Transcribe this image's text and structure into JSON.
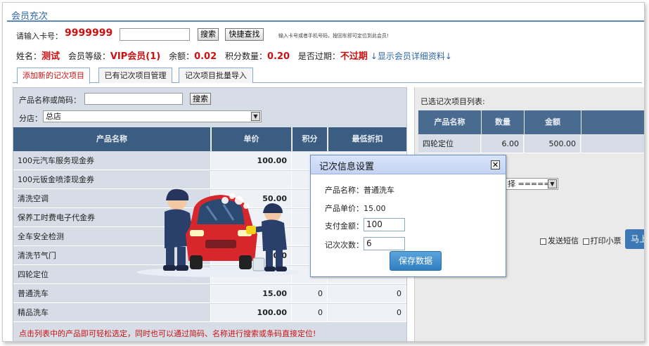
{
  "page": {
    "title": "会员充次"
  },
  "member": {
    "card_label": "请输入卡号：",
    "card_value": "9999999",
    "search_btn": "搜索",
    "quick_btn": "快捷查找",
    "hint": "输入卡号或者手机号码，按回车即可定位到此会员!",
    "name_label": "姓名：",
    "name_value": "测试",
    "level_label": "会员等级：",
    "level_value": "VIP会员(1)",
    "balance_label": "余额：",
    "balance_value": "0.02",
    "points_label": "积分数量：",
    "points_value": "0.20",
    "expired_label": "是否过期：",
    "expired_value": "不过期",
    "detail_link": "↓显示会员详细资料↓"
  },
  "tabs": [
    "添加新的记次项目",
    "已有记次项目管理",
    "记次项目批量导入"
  ],
  "left": {
    "search_label": "产品名称或简码：",
    "search_btn": "搜索",
    "store_label": "分店：",
    "store_value": "总店",
    "headers": [
      "产品名称",
      "单价",
      "积分",
      "最低折扣"
    ],
    "rows": [
      {
        "name": "100元汽车服务现金券",
        "price": "100.00",
        "points": "",
        "disc": ""
      },
      {
        "name": "100元钣金喷漆现金券",
        "price": "",
        "points": "",
        "disc": ""
      },
      {
        "name": "清洗空调",
        "price": "50.00",
        "points": "",
        "disc": ""
      },
      {
        "name": "保养工时费电子代金券",
        "price": "",
        "points": "",
        "disc": ""
      },
      {
        "name": "全车安全检测",
        "price": "",
        "points": "",
        "disc": ""
      },
      {
        "name": "清洗节气门",
        "price": "50.0",
        "points": "",
        "disc": ""
      },
      {
        "name": "四轮定位",
        "price": "",
        "points": "",
        "disc": ""
      },
      {
        "name": "普通洗车",
        "price": "15.00",
        "points": "0",
        "disc": "0"
      },
      {
        "name": "精品洗车",
        "price": "100.00",
        "points": "0",
        "disc": "0"
      }
    ],
    "footer": "点击列表中的产品即可轻松选定，同时也可以通过简码、名称进行搜索或条码直接定位!"
  },
  "right": {
    "title": "已选记次项目列表:",
    "headers": [
      "产品名称",
      "数量",
      "金额"
    ],
    "rows": [
      {
        "name": "四轮定位",
        "qty": "6.00",
        "amount": "500.00"
      }
    ],
    "select_value": "择 =====",
    "sms_label": "发送短信",
    "print_label": "打印小票",
    "submit_btn": "马上"
  },
  "dialog": {
    "title": "记次信息设置",
    "close": "✕",
    "product_label": "产品名称：",
    "product_value": "普通洗车",
    "price_label": "产品单价：",
    "price_value": "15.00",
    "pay_label": "支付金额：",
    "pay_value": "100",
    "times_label": "记次次数：",
    "times_value": "6",
    "save_btn": "保存数据"
  },
  "colors": {
    "header_bg": "#3c5d82",
    "accent_red": "#cc1111",
    "link_blue": "#2e66a8",
    "button_blue": "#2f7fc0"
  }
}
